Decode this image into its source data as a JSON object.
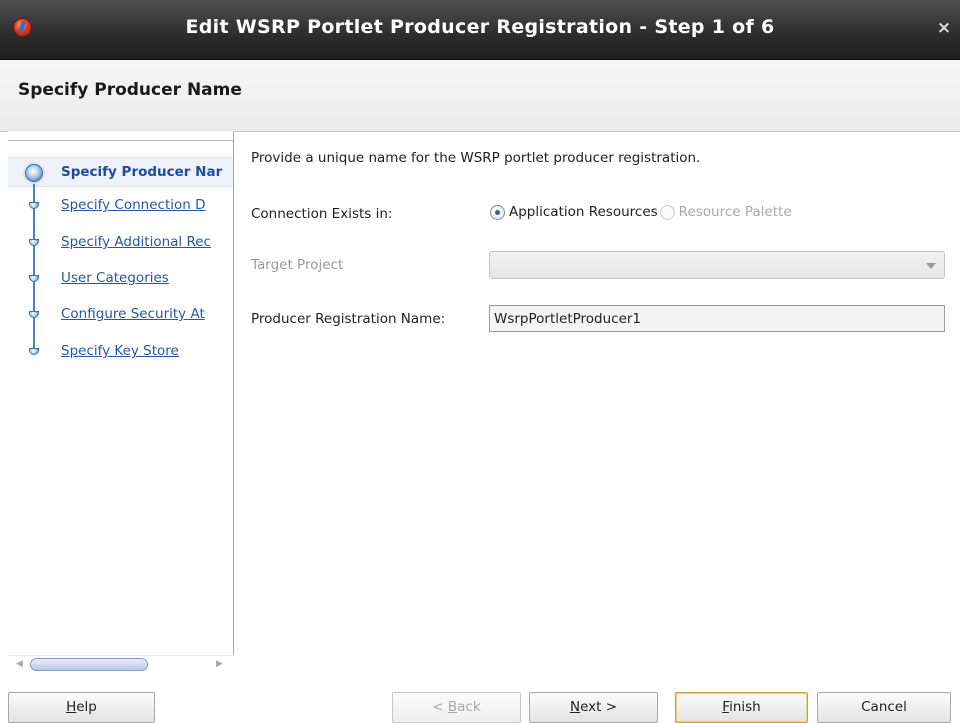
{
  "window": {
    "title": "Edit WSRP Portlet Producer Registration - Step 1 of 6",
    "close_label": "×"
  },
  "header": {
    "title": "Specify Producer Name"
  },
  "nav": {
    "steps": [
      {
        "label": "Specify Producer Nar"
      },
      {
        "label": "Specify Connection D"
      },
      {
        "label": "Specify Additional Rec"
      },
      {
        "label": "User Categories"
      },
      {
        "label": "Configure Security At"
      },
      {
        "label": "Specify Key Store"
      }
    ],
    "scroll_left": "◀",
    "scroll_right": "▶"
  },
  "form": {
    "instruction": "Provide a unique name for the WSRP portlet producer registration.",
    "connection_label": "Connection Exists in:",
    "radio_application": "Application Resources",
    "radio_palette": "Resource Palette",
    "target_project_label": "Target Project",
    "target_project_value": "",
    "producer_name_label": "Producer Registration Name:",
    "producer_name_value": "WsrpPortletProducer1"
  },
  "buttons": {
    "help": {
      "pre": "",
      "ul": "H",
      "post": "elp"
    },
    "back": {
      "pre": "< ",
      "ul": "B",
      "post": "ack"
    },
    "next": {
      "pre": "",
      "ul": "N",
      "post": "ext >"
    },
    "finish": {
      "pre": "",
      "ul": "F",
      "post": "inish"
    },
    "cancel": {
      "pre": "",
      "ul": "",
      "post": "Cancel"
    }
  },
  "colors": {
    "link": "#2a55a4",
    "titlebar": "#2c2c2c",
    "default_button_border": "#d29a3a"
  }
}
